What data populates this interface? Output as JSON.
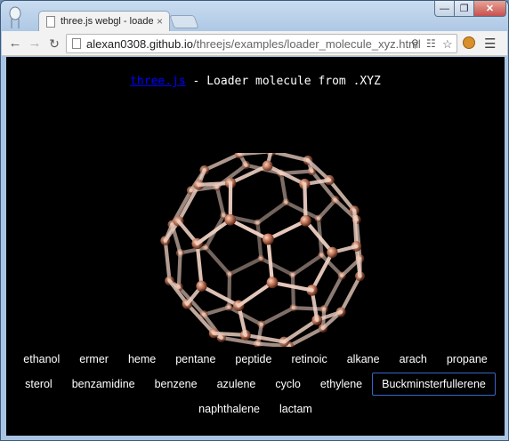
{
  "browser": {
    "tab_title": "three.js webgl - loader mo",
    "tab_close": "×",
    "url_host": "alexan0308.github.io",
    "url_path": "/threejs/examples/loader_molecule_xyz.html",
    "win_min": "—",
    "win_max": "❐",
    "win_close": "✕"
  },
  "page": {
    "link_text": "three.js",
    "title_rest": " - Loader molecule from .XYZ"
  },
  "molecules": {
    "rows": [
      [
        "ethanol",
        "ermer",
        "heme",
        "pentane",
        "peptide",
        "retinoic",
        "alkane",
        "arach",
        "propane"
      ],
      [
        "sterol",
        "benzamidine",
        "benzene",
        "azulene",
        "cyclo",
        "ethylene",
        "Buckminsterfullerene"
      ],
      [
        "naphthalene",
        "lactam"
      ]
    ],
    "selected": "Buckminsterfullerene"
  },
  "colors": {
    "atom": "#c87a5a",
    "bond": "#f0d2c4",
    "background": "#000000",
    "link": "#0000ff",
    "selected_border": "#3a66c6"
  }
}
